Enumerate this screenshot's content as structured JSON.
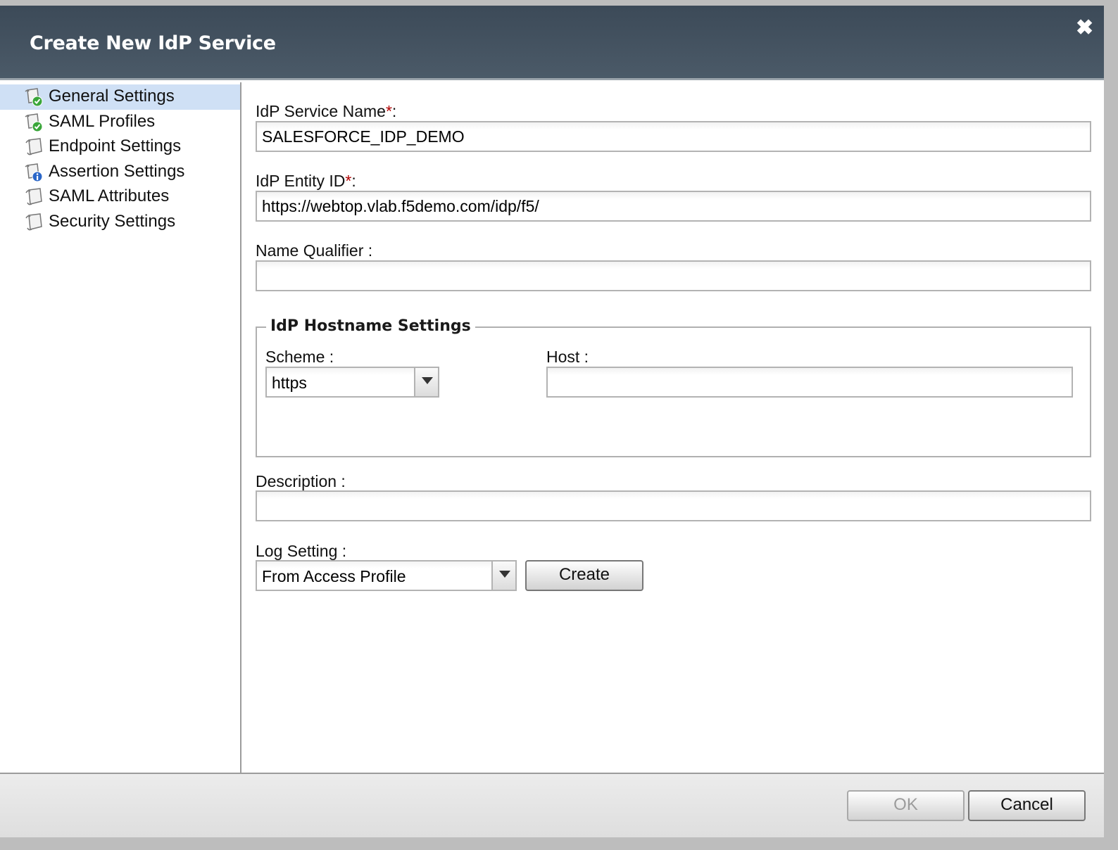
{
  "dialog": {
    "title": "Create New IdP Service",
    "close_icon": "close-icon"
  },
  "sidebar": {
    "items": [
      {
        "label": "General Settings",
        "icon": "check-doc-icon",
        "selected": true
      },
      {
        "label": "SAML Profiles",
        "icon": "check-doc-icon",
        "selected": false
      },
      {
        "label": "Endpoint Settings",
        "icon": "doc-icon",
        "selected": false
      },
      {
        "label": "Assertion Settings",
        "icon": "info-doc-icon",
        "selected": false
      },
      {
        "label": "SAML Attributes",
        "icon": "doc-icon",
        "selected": false
      },
      {
        "label": "Security Settings",
        "icon": "doc-icon",
        "selected": false
      }
    ]
  },
  "form": {
    "service_name": {
      "label": "IdP Service Name",
      "required_mark": "*",
      "suffix": ":",
      "value": "SALESFORCE_IDP_DEMO"
    },
    "entity_id": {
      "label": "IdP Entity ID",
      "required_mark": "*",
      "suffix": ":",
      "value": "https://webtop.vlab.f5demo.com/idp/f5/"
    },
    "name_qualifier": {
      "label": "Name Qualifier :",
      "value": ""
    },
    "hostname_settings": {
      "legend": "IdP Hostname Settings",
      "scheme": {
        "label": "Scheme :",
        "value": "https"
      },
      "host": {
        "label": "Host :",
        "value": ""
      }
    },
    "description": {
      "label": "Description :",
      "value": ""
    },
    "log_setting": {
      "label": "Log Setting :",
      "value": "From Access Profile",
      "create_label": "Create"
    }
  },
  "footer": {
    "ok_label": "OK",
    "cancel_label": "Cancel"
  },
  "colors": {
    "titlebar": "#435261",
    "selected_item": "#cfe0f5",
    "required": "#b00000",
    "check_green": "#3aa63a",
    "info_blue": "#2a66c8"
  }
}
